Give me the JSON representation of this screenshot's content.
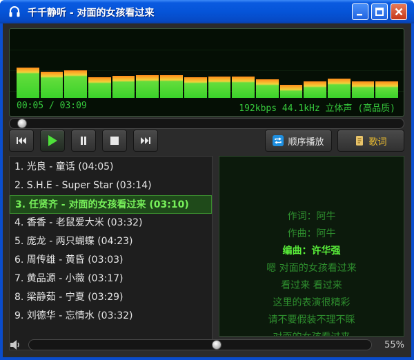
{
  "window": {
    "title": "千千静听 - 对面的女孩看过来"
  },
  "display": {
    "time": "00:05 / 03:09",
    "info": "192kbps 44.1kHz 立体声 (高品质)",
    "spectrum_levels": [
      0.49,
      0.42,
      0.44,
      0.33,
      0.36,
      0.37,
      0.37,
      0.33,
      0.34,
      0.34,
      0.3,
      0.21,
      0.27,
      0.31,
      0.27,
      0.27
    ]
  },
  "progress": {
    "position_fraction": 0.02
  },
  "controls": {
    "prev_icon": "previous-icon",
    "play_icon": "play-icon",
    "pause_icon": "pause-icon",
    "stop_icon": "stop-icon",
    "next_icon": "next-icon",
    "mode_label": "顺序播放",
    "lyrics_label": "歌词"
  },
  "playlist": [
    "1. 光良 - 童话 (04:05)",
    "2. S.H.E - Super Star (03:14)",
    "3. 任贤齐 - 对面的女孩看过来 (03:10)",
    "4. 香香 - 老鼠爱大米 (03:32)",
    "5. 庞龙 - 两只蝴蝶 (04:23)",
    "6. 周传雄 - 黄昏 (03:03)",
    "7. 黄品源 - 小薇 (03:17)",
    "8. 梁静茹 - 宁夏 (03:29)",
    "9. 刘德华 - 忘情水 (03:32)"
  ],
  "current_index": 2,
  "lyrics": [
    "作词：阿牛",
    "作曲：阿牛",
    "编曲：许华强",
    "嗯 对面的女孩看过来",
    "看过来 看过来",
    "这里的表演很精彩",
    "请不要假装不理不睬",
    "对面的女孩看过来"
  ],
  "lyrics_highlight_index": 2,
  "volume": {
    "fraction": 0.55,
    "label": "55%"
  },
  "colors": {
    "accent_green": "#36c93c",
    "highlight_green": "#5af03a",
    "title_blue": "#0554d8"
  }
}
